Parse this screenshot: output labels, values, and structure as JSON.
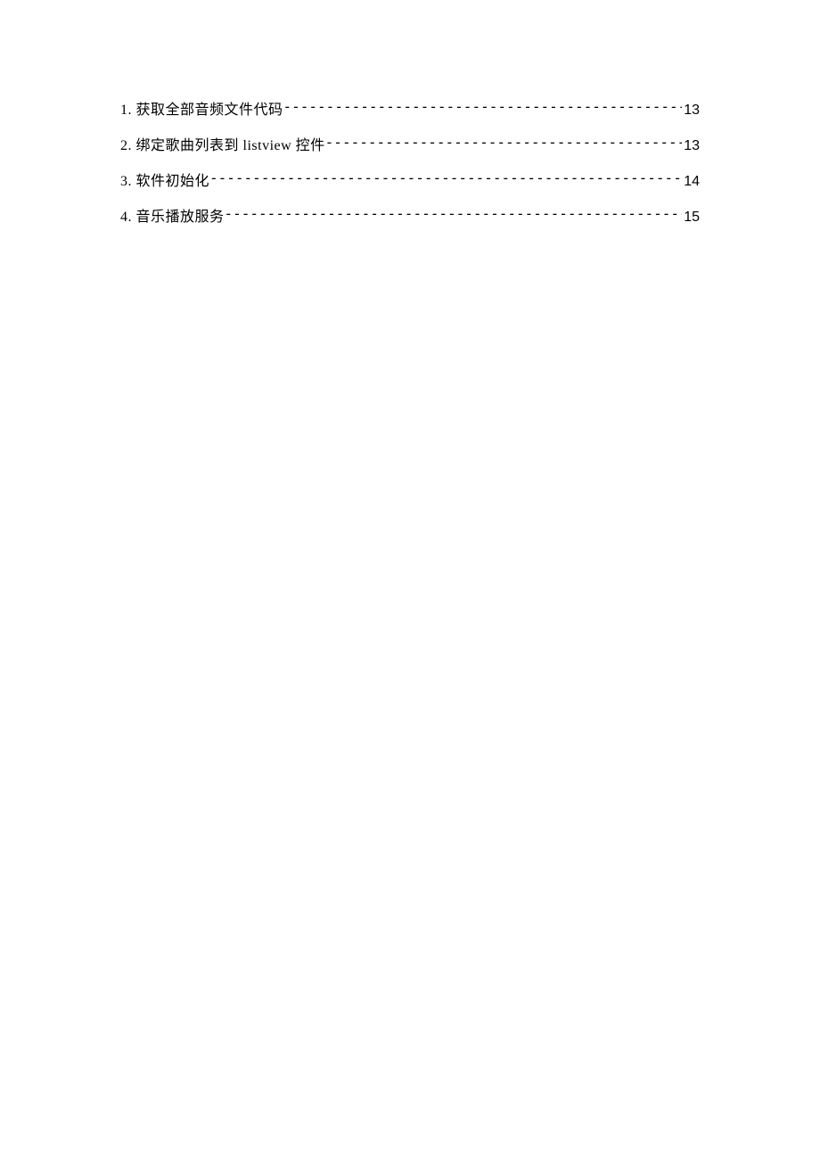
{
  "toc": {
    "entries": [
      {
        "title": "1. 获取全部音频文件代码",
        "page": "13"
      },
      {
        "title": "2. 绑定歌曲列表到 listview 控件",
        "page": "13"
      },
      {
        "title": "3. 软件初始化",
        "page": "14"
      },
      {
        "title": "4. 音乐播放服务",
        "page": "15"
      }
    ]
  }
}
